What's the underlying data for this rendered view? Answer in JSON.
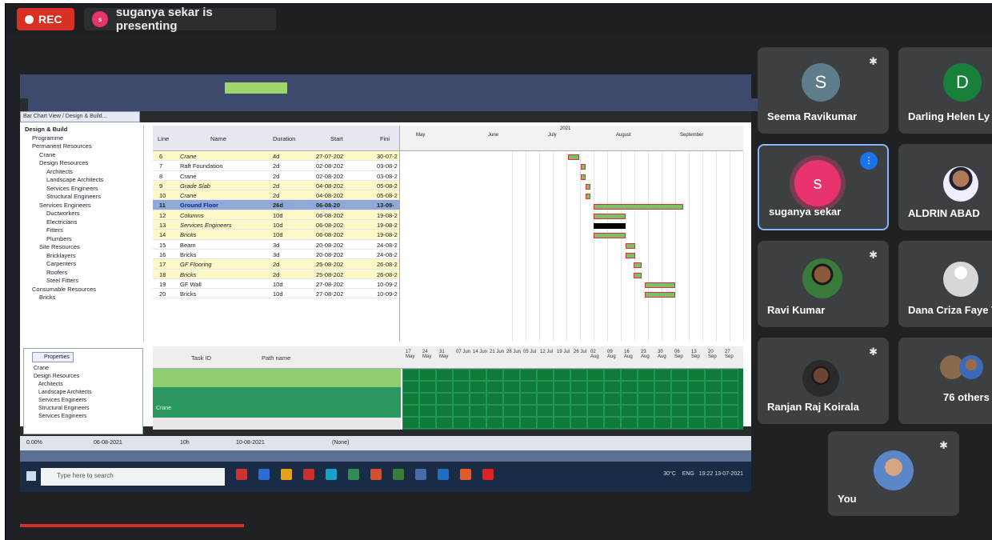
{
  "meeting": {
    "rec_label": "REC",
    "presenter_text": "suganya sekar is presenting",
    "presenter_initial": "s"
  },
  "shared_screen": {
    "view_title": "Bar Chart View / Design & Build...",
    "tree_items": [
      "Design & Build",
      "Programme",
      "Permanent Resources",
      "Crane",
      "Design Resources",
      "Architects",
      "Landscape Architects",
      "Services Engineers",
      "Structural Engineers",
      "Services Engineers",
      "Ductworkers",
      "Electricians",
      "Fitters",
      "Plumbers",
      "Site Resources",
      "Bricklayers",
      "Carpenters",
      "Roofers",
      "Steel Fitters",
      "Consumable Resources",
      "Bricks"
    ],
    "properties_label": "Properties",
    "properties_items": [
      "Crane",
      "Design Resources",
      "Architects",
      "Landscape Architects",
      "Services Engineers",
      "Structural Engineers",
      "Services Engineers"
    ],
    "grid_headers": {
      "line": "Line",
      "name": "Name",
      "duration": "Duration",
      "start": "Start",
      "finish": "Fini"
    },
    "rows": [
      {
        "line": "6",
        "name": "Crane",
        "dur": "4d",
        "start": "27-07-202",
        "finish": "30-07-2",
        "style": "y"
      },
      {
        "line": "7",
        "name": "Raft Foundation",
        "dur": "2d",
        "start": "02-08-202",
        "finish": "03-08-2",
        "style": ""
      },
      {
        "line": "8",
        "name": "Crane",
        "dur": "2d",
        "start": "02-08-202",
        "finish": "03-08-2",
        "style": ""
      },
      {
        "line": "9",
        "name": "Grade Slab",
        "dur": "2d",
        "start": "04-08-202",
        "finish": "05-08-2",
        "style": "y"
      },
      {
        "line": "10",
        "name": "Crane",
        "dur": "2d",
        "start": "04-08-202",
        "finish": "05-08-2",
        "style": "y"
      },
      {
        "line": "11",
        "name": "Ground Floor",
        "dur": "26d",
        "start": "06-08-20",
        "finish": "13-09-",
        "style": "sel"
      },
      {
        "line": "12",
        "name": "Columns",
        "dur": "10d",
        "start": "06-08-202",
        "finish": "19-08-2",
        "style": "y"
      },
      {
        "line": "13",
        "name": "Services Engineers",
        "dur": "10d",
        "start": "06-08-202",
        "finish": "19-08-2",
        "style": "y"
      },
      {
        "line": "14",
        "name": "Bricks",
        "dur": "10d",
        "start": "06-08-202",
        "finish": "19-08-2",
        "style": "y"
      },
      {
        "line": "15",
        "name": "Beam",
        "dur": "3d",
        "start": "20-08-202",
        "finish": "24-08-2",
        "style": ""
      },
      {
        "line": "16",
        "name": "Bricks",
        "dur": "3d",
        "start": "20-08-202",
        "finish": "24-08-2",
        "style": ""
      },
      {
        "line": "17",
        "name": "GF Flooring",
        "dur": "2d",
        "start": "25-08-202",
        "finish": "26-08-2",
        "style": "y"
      },
      {
        "line": "18",
        "name": "Bricks",
        "dur": "2d",
        "start": "25-08-202",
        "finish": "26-08-2",
        "style": "y"
      },
      {
        "line": "19",
        "name": "GF Wall",
        "dur": "10d",
        "start": "27-08-202",
        "finish": "10-09-2",
        "style": ""
      },
      {
        "line": "20",
        "name": "Bricks",
        "dur": "10d",
        "start": "27-08-202",
        "finish": "10-09-2",
        "style": ""
      }
    ],
    "gantt_year": "2021",
    "gantt_months": [
      "May",
      "June",
      "July",
      "August",
      "September"
    ],
    "bottom_headers": {
      "task_id": "Task ID",
      "path_name": "Path name"
    },
    "bottom_dates": [
      "17 May",
      "24 May",
      "31 May",
      "07 Jun",
      "14 Jun",
      "21 Jun",
      "28 Jun",
      "05 Jul",
      "12 Jul",
      "19 Jul",
      "26 Jul",
      "02 Aug",
      "09 Aug",
      "16 Aug",
      "23 Aug",
      "30 Aug",
      "06 Sep",
      "13 Sep",
      "20 Sep",
      "27 Sep"
    ],
    "bottom_green_label": "Crane",
    "status_zoom": "0.00%",
    "status_date": "06-08-2021",
    "status_unit": "10h",
    "status_date2": "10-08-2021",
    "status_none": "(None)",
    "taskbar_search": "Type here to search",
    "tray_temp": "30°C",
    "tray_lang": "ENG",
    "tray_time": "19:22",
    "tray_date": "13-07-2021"
  },
  "participants": [
    {
      "name": "Seema Ravikumar",
      "initial": "S",
      "color": "#5f7c8a",
      "muted": true,
      "speaking": false
    },
    {
      "name": "Darling Helen Ly",
      "initial": "D",
      "color": "#188038",
      "muted": false,
      "speaking": false
    },
    {
      "name": "suganya sekar",
      "initial": "s",
      "color": "#e8336c",
      "muted": false,
      "speaking": true
    },
    {
      "name": "ALDRIN ABAD",
      "muted": false,
      "speaking": false
    },
    {
      "name": "Ravi Kumar",
      "muted": true,
      "speaking": false
    },
    {
      "name": "Dana Criza Faye V",
      "muted": false,
      "speaking": false
    },
    {
      "name": "Ranjan Raj Koirala",
      "muted": true,
      "speaking": false
    },
    {
      "name": "76 others",
      "muted": false,
      "speaking": false
    },
    {
      "name": "You",
      "muted": true,
      "speaking": false
    }
  ]
}
